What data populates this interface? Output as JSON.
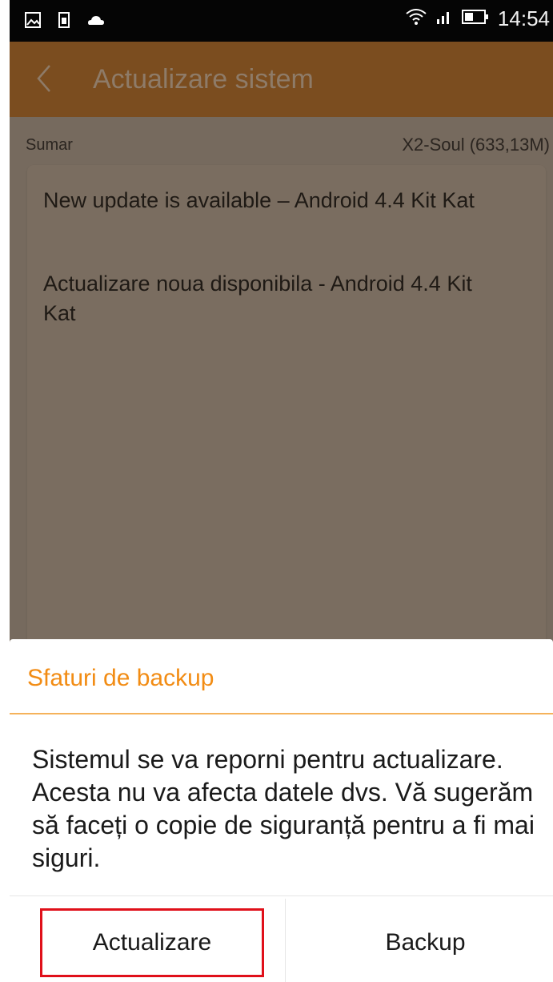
{
  "status_bar": {
    "time": "14:54",
    "icons": [
      "image-icon",
      "battery-saver-icon",
      "cloud-icon",
      "wifi-icon",
      "signal-icon",
      "battery-icon"
    ]
  },
  "app_bar": {
    "title": "Actualizare sistem",
    "back_icon": "chevron-left-icon"
  },
  "summary": {
    "label": "Sumar",
    "value": "X2-Soul (633,13M)"
  },
  "release_notes": {
    "english": "New update is available – Android 4.4 Kit Kat",
    "romanian": "Actualizare noua disponibila - Android 4.4 Kit Kat"
  },
  "dialog": {
    "title": "Sfaturi de backup",
    "message": "Sistemul se va reporni pentru actualizare. Acesta nu va afecta datele dvs. Vă sugerăm să faceți o copie de siguranță pentru a fi mai siguri.",
    "buttons": {
      "update_label": "Actualizare",
      "backup_label": "Backup"
    }
  },
  "colors": {
    "accent": "#f28c14",
    "highlight": "#e0101a",
    "app_bar": "#7b4d1f",
    "dim_background": "#766a5e"
  }
}
